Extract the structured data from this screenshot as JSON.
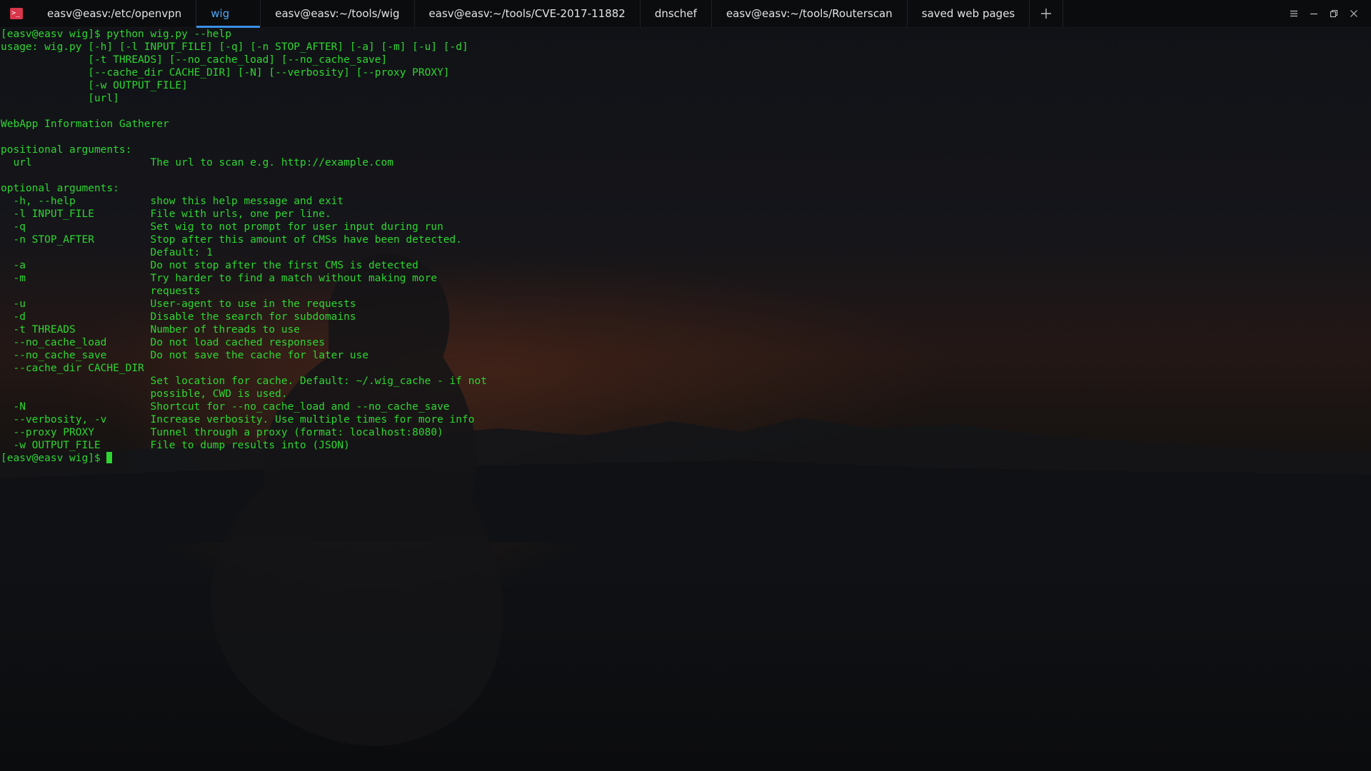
{
  "tabs": [
    {
      "label": "easv@easv:/etc/openvpn",
      "active": false
    },
    {
      "label": "wig",
      "active": true
    },
    {
      "label": "easv@easv:~/tools/wig",
      "active": false
    },
    {
      "label": "easv@easv:~/tools/CVE-2017-11882",
      "active": false
    },
    {
      "label": "dnschef",
      "active": false
    },
    {
      "label": "easv@easv:~/tools/Routerscan",
      "active": false
    },
    {
      "label": "saved web pages",
      "active": false
    }
  ],
  "app_icon_glyph": ">_",
  "colors": {
    "text": "#2ed630",
    "active_tab": "#4aa8f5",
    "tab_underline": "#3a8ee6",
    "app_icon": "#d8364a"
  },
  "terminal": {
    "lines": [
      "[easv@easv wig]$ python wig.py --help",
      "usage: wig.py [-h] [-l INPUT_FILE] [-q] [-n STOP_AFTER] [-a] [-m] [-u] [-d]",
      "              [-t THREADS] [--no_cache_load] [--no_cache_save]",
      "              [--cache_dir CACHE_DIR] [-N] [--verbosity] [--proxy PROXY]",
      "              [-w OUTPUT_FILE]",
      "              [url]",
      "",
      "WebApp Information Gatherer",
      "",
      "positional arguments:",
      "  url                   The url to scan e.g. http://example.com",
      "",
      "optional arguments:",
      "  -h, --help            show this help message and exit",
      "  -l INPUT_FILE         File with urls, one per line.",
      "  -q                    Set wig to not prompt for user input during run",
      "  -n STOP_AFTER         Stop after this amount of CMSs have been detected.",
      "                        Default: 1",
      "  -a                    Do not stop after the first CMS is detected",
      "  -m                    Try harder to find a match without making more",
      "                        requests",
      "  -u                    User-agent to use in the requests",
      "  -d                    Disable the search for subdomains",
      "  -t THREADS            Number of threads to use",
      "  --no_cache_load       Do not load cached responses",
      "  --no_cache_save       Do not save the cache for later use",
      "  --cache_dir CACHE_DIR",
      "                        Set location for cache. Default: ~/.wig_cache - if not",
      "                        possible, CWD is used.",
      "  -N                    Shortcut for --no_cache_load and --no_cache_save",
      "  --verbosity, -v       Increase verbosity. Use multiple times for more info",
      "  --proxy PROXY         Tunnel through a proxy (format: localhost:8080)",
      "  -w OUTPUT_FILE        File to dump results into (JSON)"
    ],
    "prompt": "[easv@easv wig]$ "
  }
}
